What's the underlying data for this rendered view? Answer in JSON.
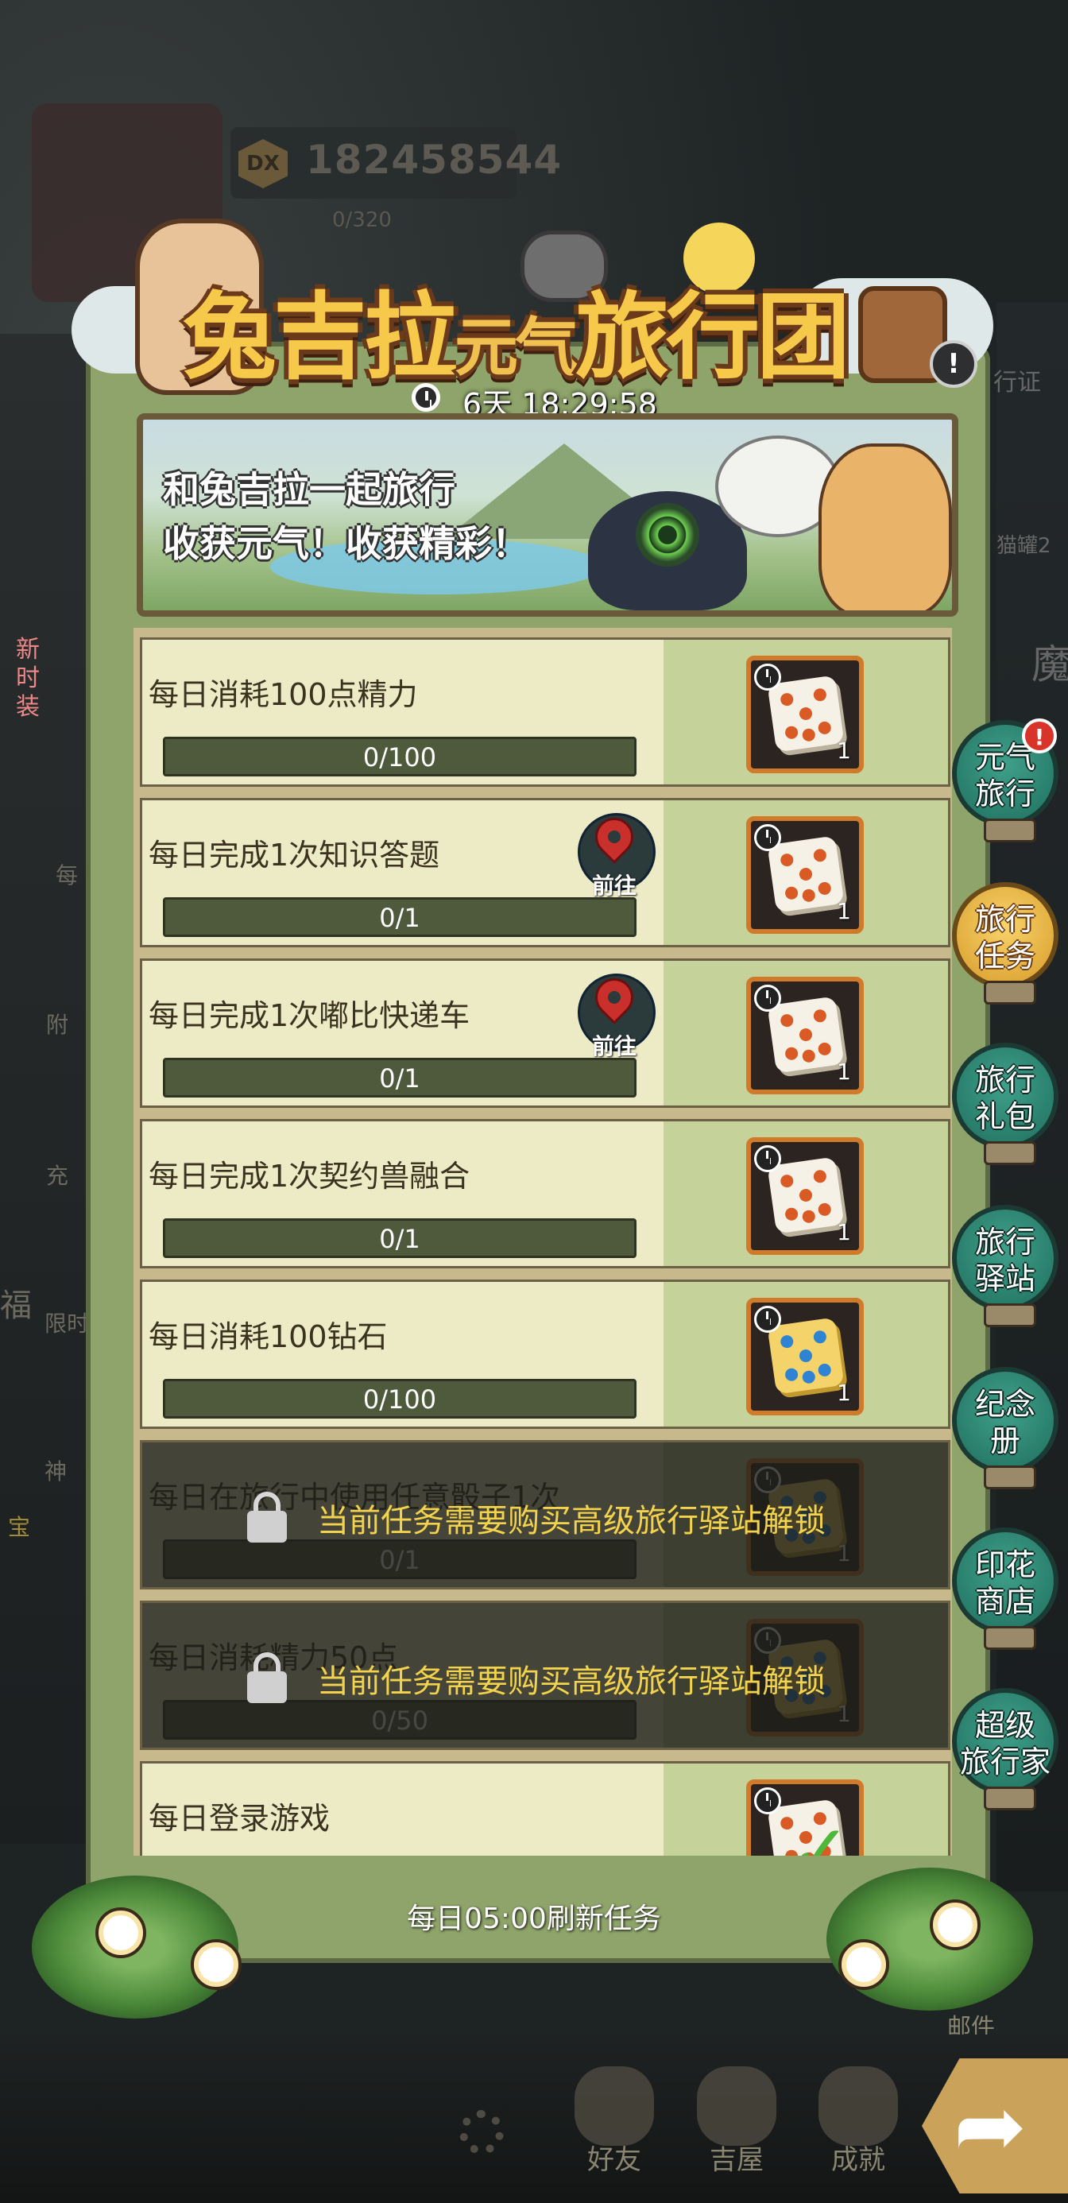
{
  "hud": {
    "currency_value": "182458544",
    "energy_value": "0/320",
    "currency_icon_symbol": "DX"
  },
  "background_labels": {
    "left": [
      "新时装",
      "每",
      "附",
      "充",
      "福",
      "限时",
      "神",
      "宝"
    ],
    "right": [
      "行证",
      "猫罐2",
      "魔",
      "邮件"
    ]
  },
  "event": {
    "title_main": "兔吉拉",
    "title_small": "元气",
    "title_tail": "旅行团",
    "countdown": "6天 18:29:58",
    "info_symbol": "!",
    "intro_line1": "和兔吉拉一起旅行",
    "intro_line2": "收获元气！收获精彩！",
    "refresh_note": "每日05:00刷新任务"
  },
  "tasks": [
    {
      "title": "每日消耗100点精力",
      "progress": "0/100",
      "progress_fraction": 0,
      "reward_count": "1",
      "dice": "white",
      "goto": false,
      "locked": false
    },
    {
      "title": "每日完成1次知识答题",
      "progress": "0/1",
      "progress_fraction": 0,
      "reward_count": "1",
      "dice": "white",
      "goto": true,
      "locked": false
    },
    {
      "title": "每日完成1次嘟比快递车",
      "progress": "0/1",
      "progress_fraction": 0,
      "reward_count": "1",
      "dice": "white",
      "goto": true,
      "locked": false
    },
    {
      "title": "每日完成1次契约兽融合",
      "progress": "0/1",
      "progress_fraction": 0,
      "reward_count": "1",
      "dice": "white",
      "goto": false,
      "locked": false
    },
    {
      "title": "每日消耗100钻石",
      "progress": "0/100",
      "progress_fraction": 0,
      "reward_count": "1",
      "dice": "blue",
      "goto": false,
      "locked": false
    },
    {
      "title": "每日在旅行中使用任意骰子1次",
      "progress": "0/1",
      "progress_fraction": 0,
      "reward_count": "1",
      "dice": "blue",
      "goto": false,
      "locked": true
    },
    {
      "title": "每日消耗精力50点",
      "progress": "0/50",
      "progress_fraction": 0,
      "reward_count": "1",
      "dice": "blue",
      "goto": false,
      "locked": true
    },
    {
      "title": "每日登录游戏",
      "progress": "",
      "progress_fraction": 1,
      "reward_count": "",
      "dice": "white",
      "goto": false,
      "locked": false,
      "completed": true
    }
  ],
  "goto_label": "前往",
  "lock_message": "当前任务需要购买高级旅行驿站解锁",
  "side_tabs": [
    {
      "label": "元气旅行",
      "line1": "元气",
      "line2": "旅行",
      "badge": "!",
      "active": false
    },
    {
      "label": "旅行任务",
      "line1": "旅行",
      "line2": "任务",
      "active": true
    },
    {
      "label": "旅行礼包",
      "line1": "旅行",
      "line2": "礼包",
      "active": false
    },
    {
      "label": "旅行驿站",
      "line1": "旅行",
      "line2": "驿站",
      "active": false
    },
    {
      "label": "纪念册",
      "line1": "纪念",
      "line2": "册",
      "active": false
    },
    {
      "label": "印花商店",
      "line1": "印花",
      "line2": "商店",
      "active": false
    },
    {
      "label": "超级旅行家",
      "line1": "超级",
      "line2": "旅行家",
      "active": false
    }
  ],
  "bottom_nav": [
    {
      "label": "好友",
      "icon": "friend-icon"
    },
    {
      "label": "吉屋",
      "icon": "house-icon"
    },
    {
      "label": "成就",
      "icon": "trophy-icon"
    }
  ],
  "colors": {
    "panel": "#8fa46a",
    "row_bg": "#ecebc5",
    "reward_bg": "#c5d39b",
    "bar": "#4f5a3d",
    "lock_text": "#f3d24c",
    "title_gold": "#f7c94b",
    "tab_teal": "#2f8a76",
    "tab_active": "#e8b648"
  }
}
